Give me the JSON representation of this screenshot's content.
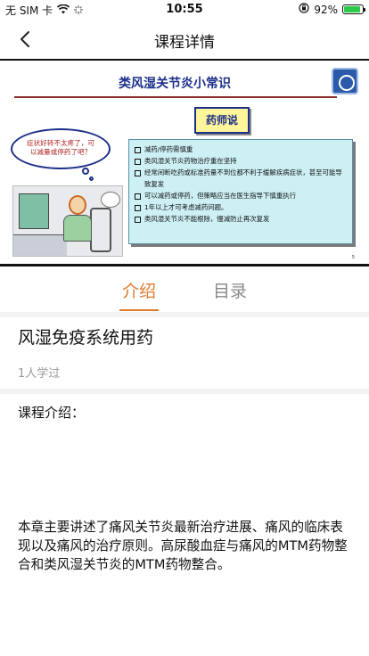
{
  "status_bar": {
    "carrier": "无 SIM 卡",
    "time": "10:55",
    "battery_percent": "92%",
    "battery_level": 0.92
  },
  "nav": {
    "title": "课程详情"
  },
  "slide": {
    "title": "类风湿关节炎小常识",
    "tag": "药师说",
    "bubble_text": "症状好转不太疼了，可以减量或停药了吧？",
    "bullets": [
      "减药/停药需慎重",
      "类风湿关节炎药物治疗重在坚持",
      "经常间断吃药或标准药量不到位都不利于缓解疾病症状，甚至可能导致复发",
      "可以减药或停药，但策略应当在医生指导下慎重执行",
      "1年以上才可考虑减药问题。",
      "类风湿关节炎不能根除，慢减防止再次复发"
    ],
    "page_number": "5"
  },
  "tabs": {
    "intro": "介绍",
    "catalog": "目录",
    "active": "intro"
  },
  "course": {
    "title": "风湿免疫系统用药",
    "learned": "1人学过",
    "intro_label": "课程介绍：",
    "intro_text": "本章主要讲述了痛风关节炎最新治疗进展、痛风的临床表现以及痛风的治疗原则。高尿酸血症与痛风的MTM药物整合和类风湿关节炎的MTM药物整合。"
  },
  "colors": {
    "accent": "#e07a2f",
    "battery": "#2cc94a",
    "slide_title": "#1c2f8a"
  }
}
